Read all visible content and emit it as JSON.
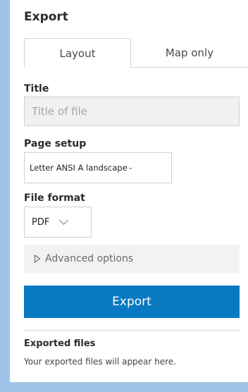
{
  "panel": {
    "title": "Export"
  },
  "tabs": [
    {
      "label": "Layout",
      "selected": true
    },
    {
      "label": "Map only",
      "selected": false
    }
  ],
  "form": {
    "title_label": "Title",
    "title_placeholder": "Title of file",
    "title_value": "",
    "page_setup_label": "Page setup",
    "page_setup_value": "Letter ANSI A landscape",
    "file_format_label": "File format",
    "file_format_value": "PDF",
    "advanced_label": "Advanced options"
  },
  "actions": {
    "export_label": "Export"
  },
  "exported": {
    "heading": "Exported files",
    "empty_message": "Your exported files will appear here."
  },
  "colors": {
    "accent": "#0979c1",
    "frame": "#9fc3e6"
  },
  "icons": {
    "page_setup_chevron": "chevron-down-icon",
    "file_format_chevron": "chevron-down-icon",
    "advanced_toggle": "caret-right-icon"
  }
}
